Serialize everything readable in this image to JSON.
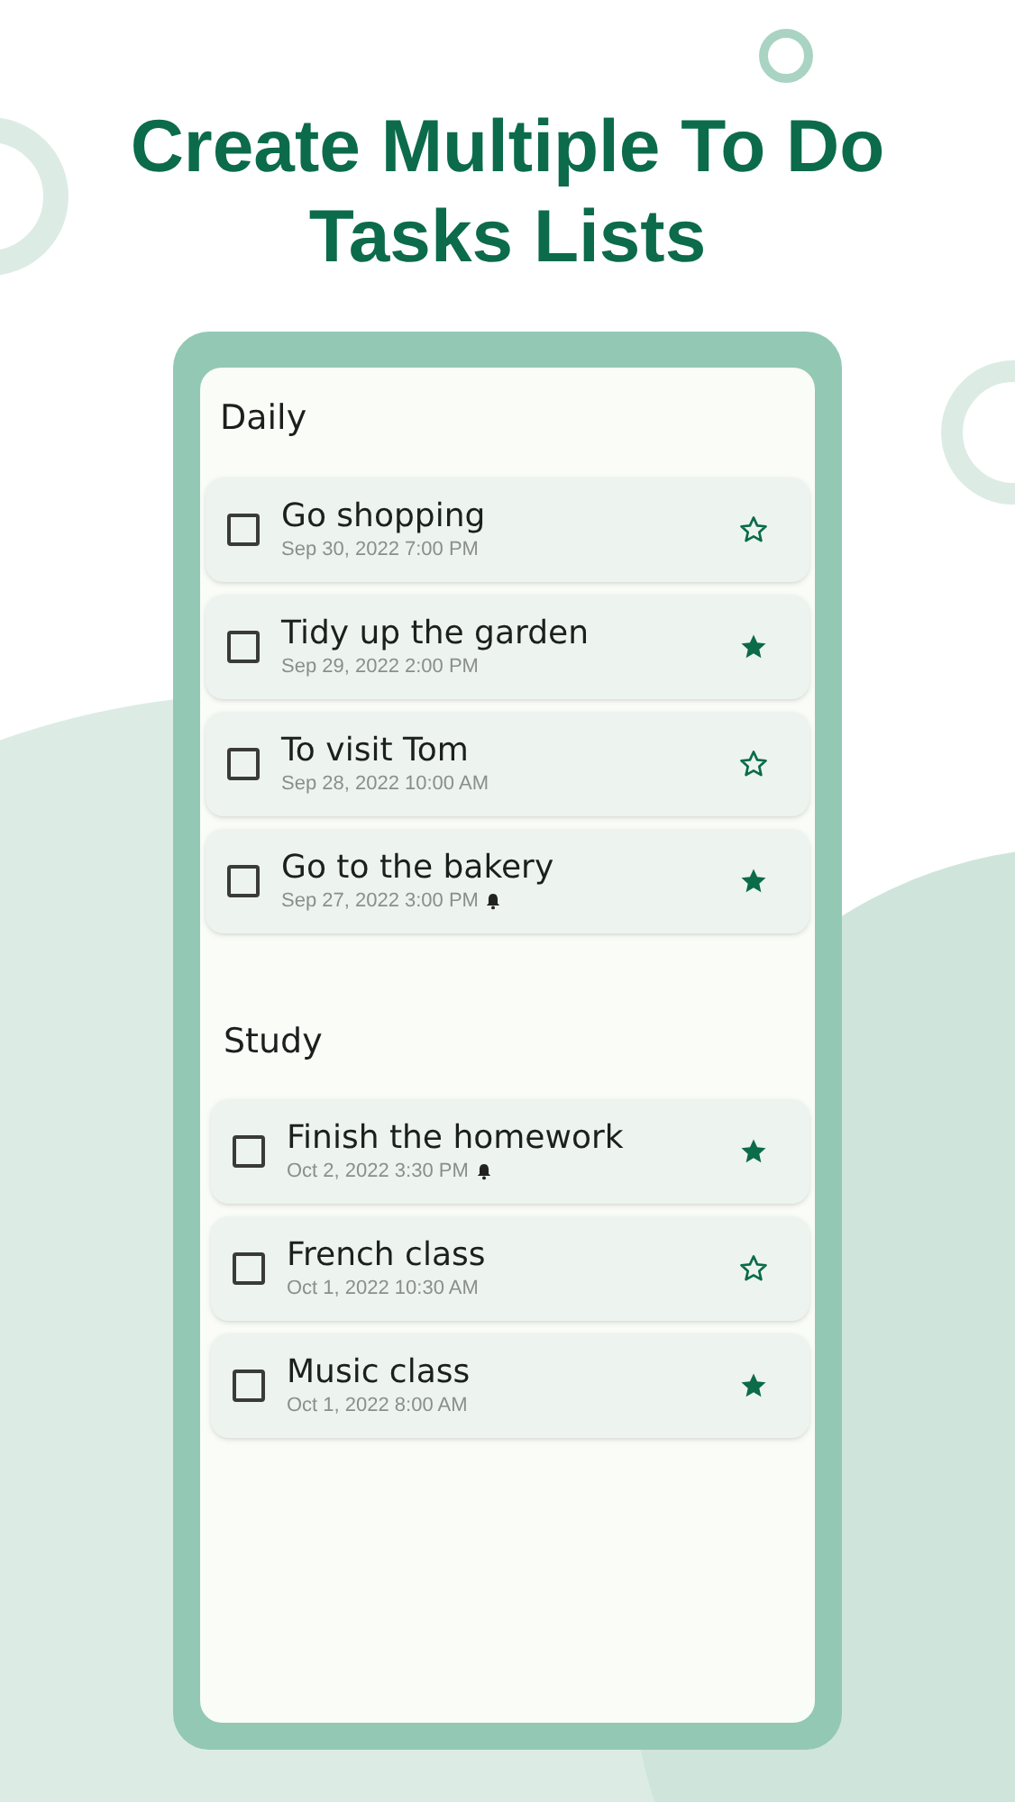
{
  "headline": "Create Multiple To Do Tasks Lists",
  "lists": [
    {
      "title": "Daily",
      "tasks": [
        {
          "title": "Go shopping",
          "date": "Sep 30, 2022 7:00 PM",
          "checked": false,
          "starred": false,
          "alarm": false
        },
        {
          "title": "Tidy up the garden",
          "date": "Sep 29, 2022 2:00 PM",
          "checked": false,
          "starred": true,
          "alarm": false
        },
        {
          "title": "To visit Tom",
          "date": "Sep 28, 2022 10:00 AM",
          "checked": false,
          "starred": false,
          "alarm": false
        },
        {
          "title": "Go to the bakery",
          "date": "Sep 27, 2022 3:00 PM",
          "checked": false,
          "starred": true,
          "alarm": true
        }
      ]
    },
    {
      "title": "Study",
      "tasks": [
        {
          "title": "Finish the homework",
          "date": "Oct 2, 2022 3:30 PM",
          "checked": false,
          "starred": true,
          "alarm": true
        },
        {
          "title": "French class",
          "date": "Oct 1, 2022 10:30 AM",
          "checked": false,
          "starred": false,
          "alarm": false
        },
        {
          "title": "Music class",
          "date": "Oct 1, 2022 8:00 AM",
          "checked": false,
          "starred": true,
          "alarm": false
        }
      ]
    }
  ]
}
